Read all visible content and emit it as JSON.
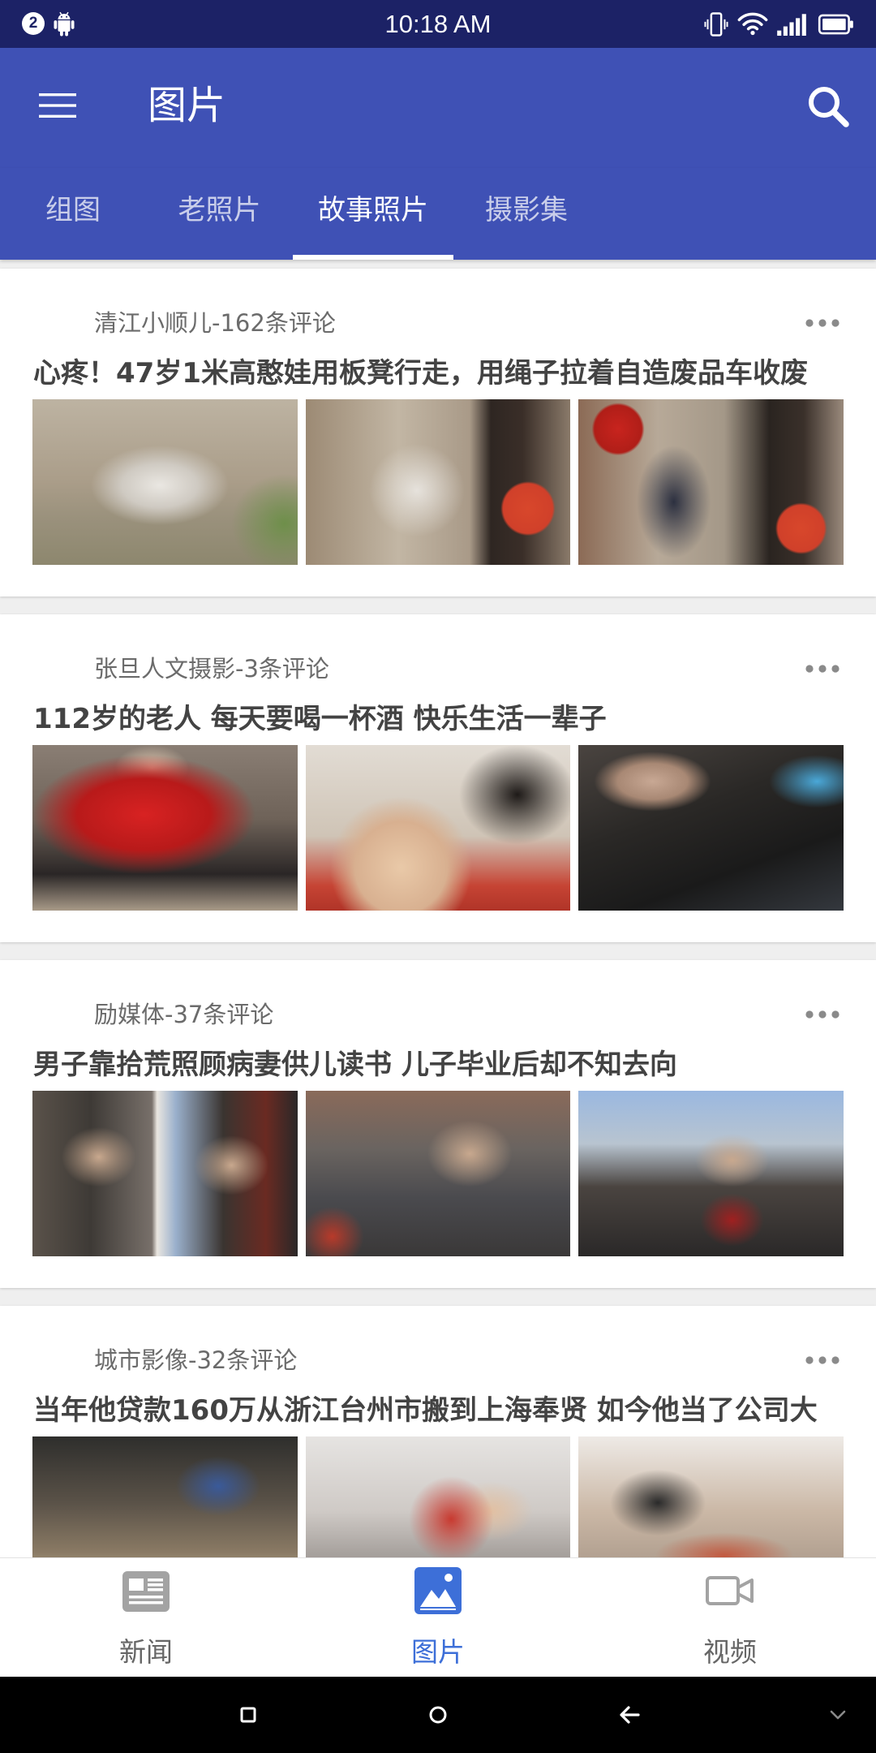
{
  "theme": {
    "status_bar_color": "#1c2266",
    "primary_color": "#3f51b5",
    "selected_color": "#3d6fd8"
  },
  "status_bar": {
    "notification_count": "2",
    "time": "10:18 AM",
    "left_icons": [
      "android-icon"
    ],
    "right_icons": [
      "vibrate-icon",
      "wifi-icon",
      "signal-icon",
      "battery-icon"
    ]
  },
  "app_bar": {
    "title": "图片",
    "menu_icon": "menu-icon",
    "search_icon": "search-icon"
  },
  "tabs": [
    {
      "label": "组图",
      "selected": false
    },
    {
      "label": "老照片",
      "selected": false
    },
    {
      "label": "故事照片",
      "selected": true
    },
    {
      "label": "摄影集",
      "selected": false
    }
  ],
  "cards": [
    {
      "source": "清江小顺儿-162条评论",
      "title": "心疼！47岁1米高憨娃用板凳行走，用绳子拉着自造废品车收废",
      "more_icon": "more-horizontal-icon"
    },
    {
      "source": "张旦人文摄影-3条评论",
      "title": "112岁的老人 每天要喝一杯酒 快乐生活一辈子",
      "more_icon": "more-horizontal-icon"
    },
    {
      "source": "励媒体-37条评论",
      "title": "男子靠拾荒照顾病妻供儿读书 儿子毕业后却不知去向",
      "more_icon": "more-horizontal-icon"
    },
    {
      "source": "城市影像-32条评论",
      "title": "当年他贷款160万从浙江台州市搬到上海奉贤 如今他当了公司大",
      "more_icon": "more-horizontal-icon"
    }
  ],
  "bottom_nav": [
    {
      "label": "新闻",
      "icon": "news-icon",
      "selected": false
    },
    {
      "label": "图片",
      "icon": "image-icon",
      "selected": true
    },
    {
      "label": "视频",
      "icon": "video-icon",
      "selected": false
    }
  ],
  "system_nav": {
    "icons": [
      "recents-icon",
      "home-icon",
      "back-icon",
      "hide-nav-icon"
    ]
  }
}
